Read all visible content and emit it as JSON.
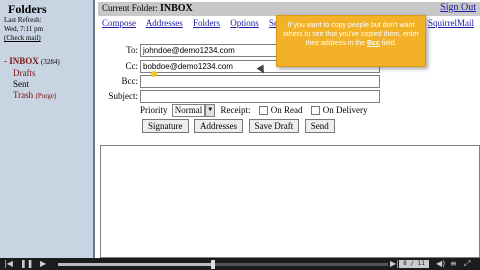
{
  "sidebar": {
    "title": "Folders",
    "last_refresh_label": "Last Refresh:",
    "last_refresh_time": "Wed, 7:11 pm",
    "check_mail": "(Check mail)",
    "folders": [
      {
        "name": "INBOX",
        "count": "(3284)"
      },
      {
        "name": "Drafts"
      },
      {
        "name": "Sent"
      },
      {
        "name": "Trash",
        "extra": "(Purge)"
      }
    ]
  },
  "header": {
    "current_folder_label": "Current Folder:",
    "current_folder": "INBOX",
    "sign_out": "Sign Out"
  },
  "menu": {
    "items": [
      "Compose",
      "Addresses",
      "Folders",
      "Options",
      "Se"
    ],
    "brand": "SquirrelMail"
  },
  "compose": {
    "to_label": "To:",
    "to_value": "johndoe@demo1234.com",
    "cc_label": "Cc:",
    "cc_value": "bobdoe@demo1234.com",
    "bcc_label": "Bcc:",
    "bcc_value": "",
    "subject_label": "Subject:",
    "subject_value": "",
    "priority_label": "Priority",
    "priority_value": "Normal",
    "receipt_label": "Receipt:",
    "on_read": "On Read",
    "on_delivery": "On Delivery",
    "buttons": {
      "signature": "Signature",
      "addresses": "Addresses",
      "save_draft": "Save Draft",
      "send": "Send"
    }
  },
  "tooltip": {
    "text_before": "If you want to copy people but don't want others to see that you've copied them, enter their address in the ",
    "bold": "Bcc",
    "text_after": " field."
  },
  "player": {
    "time": "8 / 11",
    "progress_fraction": 0.47
  }
}
